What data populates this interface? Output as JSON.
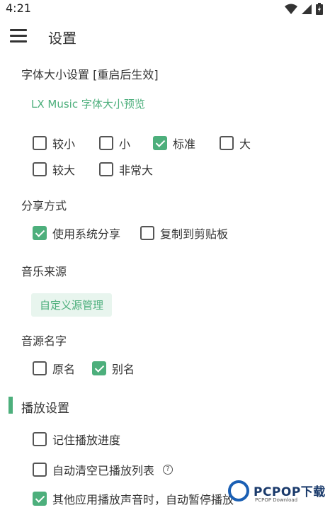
{
  "status_bar": {
    "time": "4:21"
  },
  "app_bar": {
    "title": "设置"
  },
  "font_size": {
    "label": "字体大小设置 [重启后生效]",
    "preview": "LX Music 字体大小预览",
    "options": [
      {
        "label": "较小",
        "checked": false
      },
      {
        "label": "小",
        "checked": false
      },
      {
        "label": "标准",
        "checked": true
      },
      {
        "label": "大",
        "checked": false
      },
      {
        "label": "较大",
        "checked": false
      },
      {
        "label": "非常大",
        "checked": false
      }
    ]
  },
  "share": {
    "label": "分享方式",
    "options": [
      {
        "label": "使用系统分享",
        "checked": true
      },
      {
        "label": "复制到剪贴板",
        "checked": false
      }
    ]
  },
  "music_source": {
    "label": "音乐来源",
    "button": "自定义源管理"
  },
  "source_name": {
    "label": "音源名字",
    "options": [
      {
        "label": "原名",
        "checked": false
      },
      {
        "label": "别名",
        "checked": true
      }
    ]
  },
  "playback": {
    "title": "播放设置",
    "options": [
      {
        "label": "记住播放进度",
        "checked": false
      },
      {
        "label": "自动清空已播放列表",
        "checked": false
      },
      {
        "label": "其他应用播放声音时，自动暂停播放",
        "checked": true
      }
    ],
    "help_glyph": "?"
  },
  "watermark": {
    "main": "PCPOP下载",
    "sub": "PCPOP Download"
  },
  "colors": {
    "accent": "#4daf7c",
    "chip_bg": "#e8f5ee"
  }
}
